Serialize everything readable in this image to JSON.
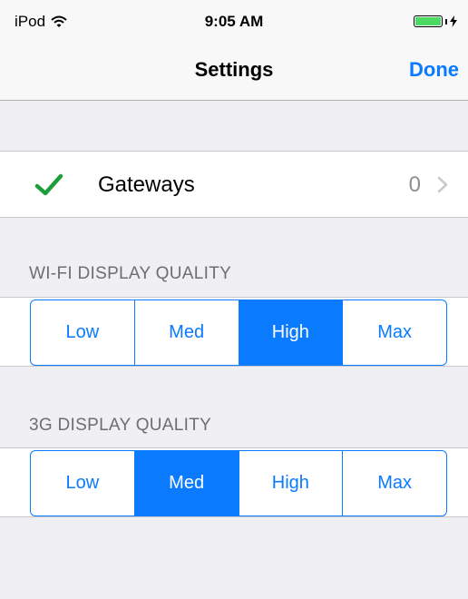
{
  "status_bar": {
    "device": "iPod",
    "time": "9:05 AM"
  },
  "nav": {
    "title": "Settings",
    "done_label": "Done"
  },
  "gateways": {
    "label": "Gateways",
    "count": "0"
  },
  "wifi_quality": {
    "header": "WI-FI DISPLAY QUALITY",
    "options": [
      "Low",
      "Med",
      "High",
      "Max"
    ],
    "selected": "High"
  },
  "cellular_quality": {
    "header": "3G DISPLAY QUALITY",
    "options": [
      "Low",
      "Med",
      "High",
      "Max"
    ],
    "selected": "Med"
  },
  "colors": {
    "accent": "#0a7aff",
    "check": "#1e9e3a",
    "battery": "#4cd964",
    "background": "#efeff4"
  },
  "icons": {
    "wifi": "wifi-icon",
    "battery": "battery-icon",
    "charging": "charging-bolt-icon",
    "check": "checkmark-icon",
    "disclosure": "chevron-right-icon"
  }
}
